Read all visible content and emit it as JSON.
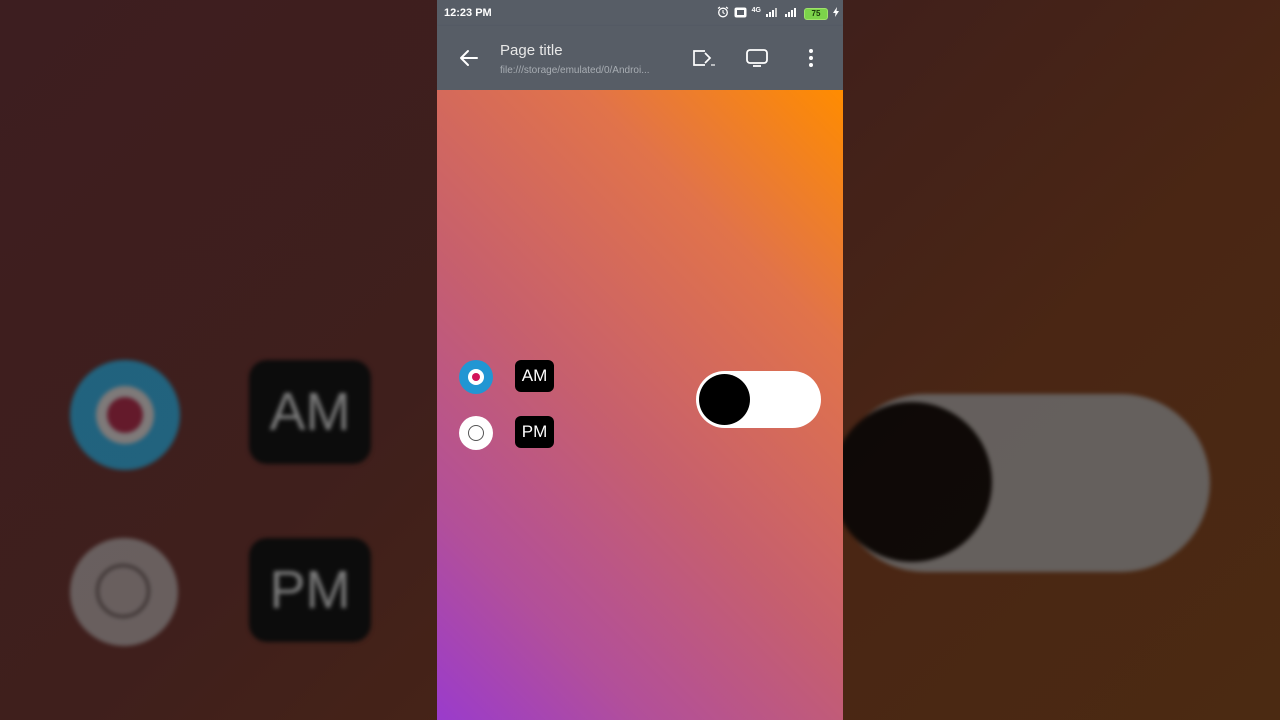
{
  "status_bar": {
    "time": "12:23 PM",
    "battery": "75",
    "network": "4G"
  },
  "app_bar": {
    "title": "Page title",
    "url": "file:///storage/emulated/0/Androi..."
  },
  "options": {
    "am_label": "AM",
    "pm_label": "PM",
    "selected": "AM"
  },
  "backdrop": {
    "am_label": "AM",
    "pm_label": "PM"
  },
  "toggle": {
    "on": false
  },
  "colors": {
    "radio_selected_ring": "#2196d3",
    "radio_selected_dot": "#d3145a",
    "gradient_top": "#ff8c00",
    "gradient_bottom": "#9a3bcc"
  }
}
